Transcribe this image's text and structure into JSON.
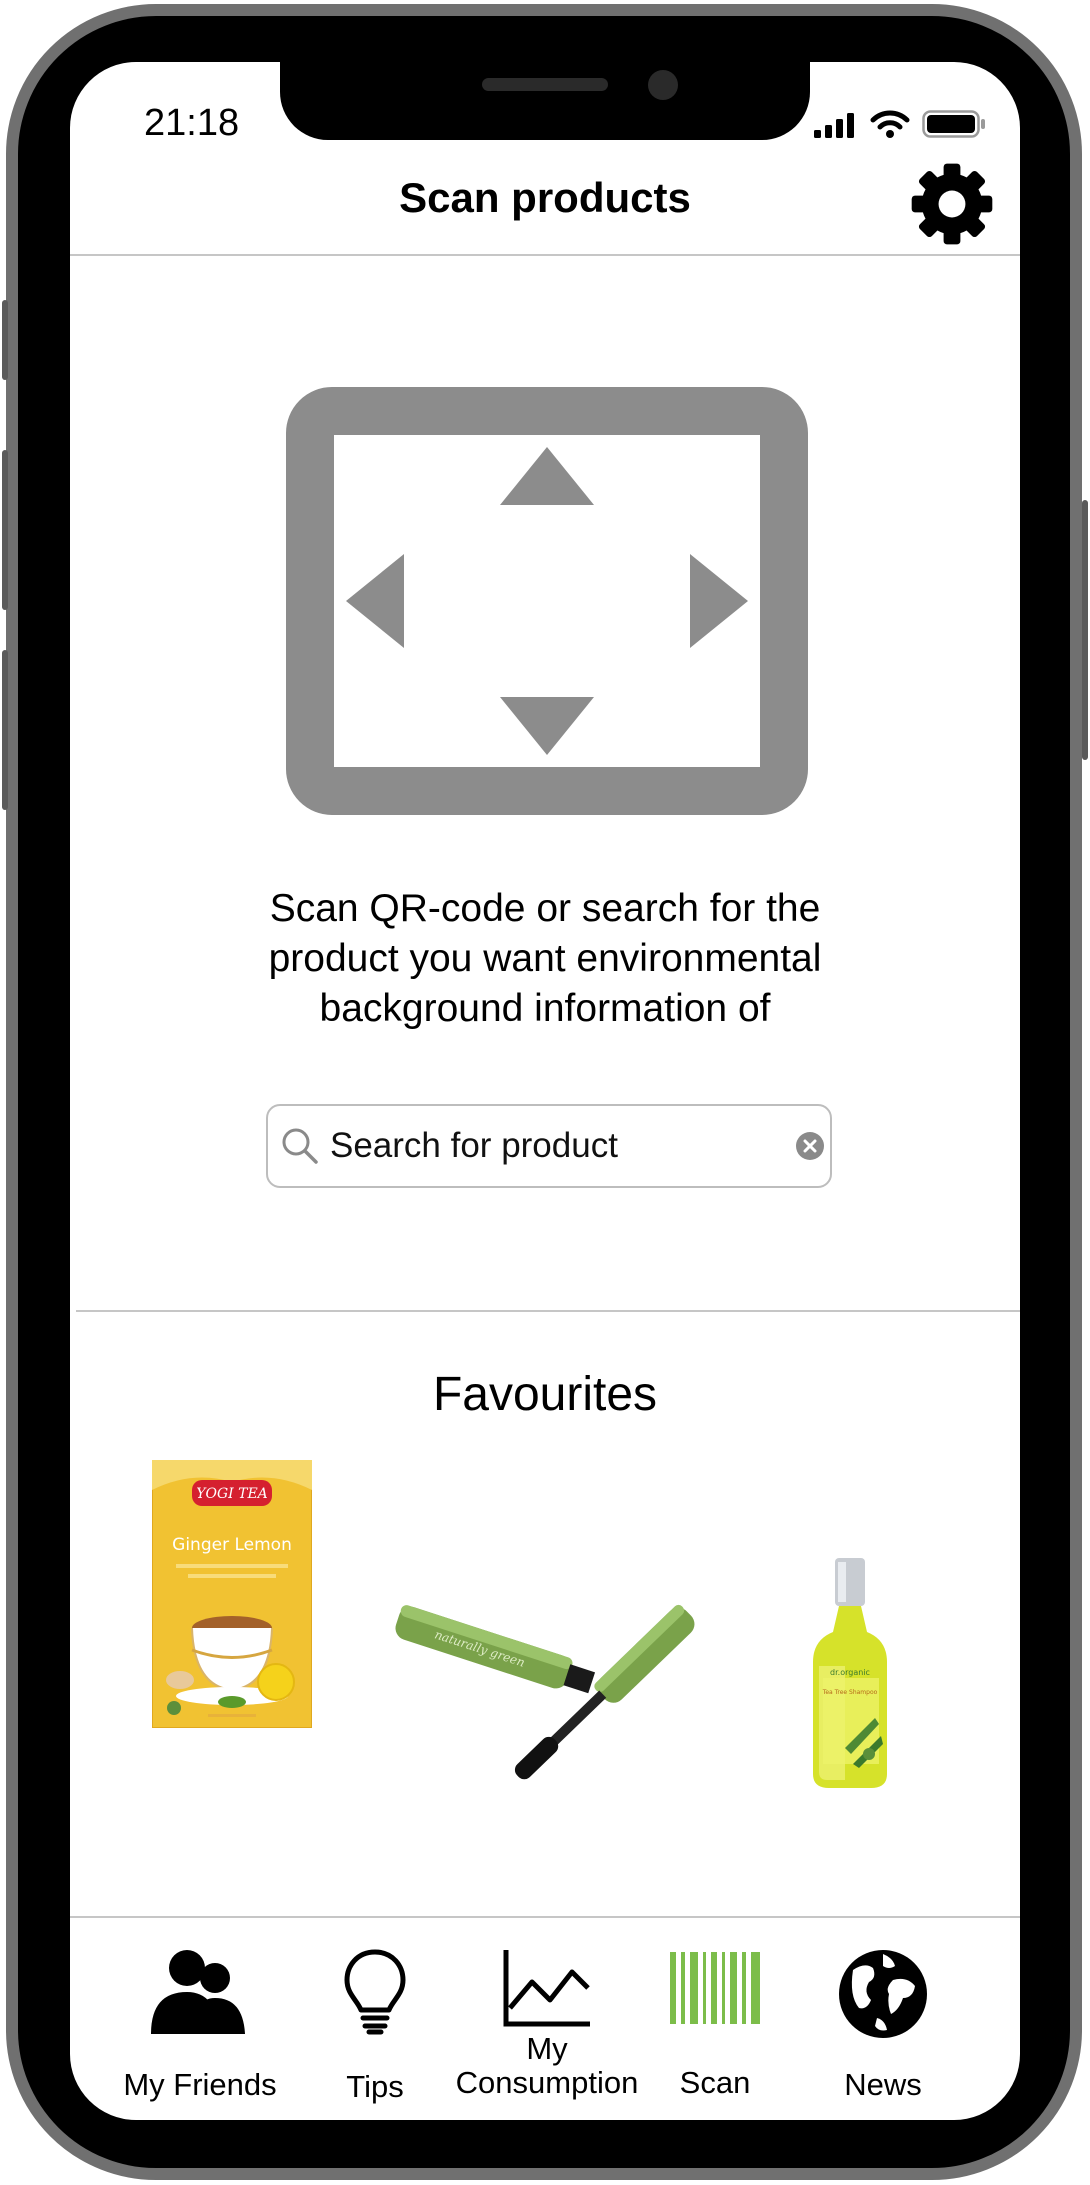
{
  "status_bar": {
    "time": "21:18",
    "icons": [
      "signal-icon",
      "wifi-icon",
      "battery-icon"
    ]
  },
  "header": {
    "title": "Scan products",
    "settings_icon": "gear-icon"
  },
  "scanner": {
    "icon": "scan-frame-icon",
    "instructions": "Scan QR-code or search for the product you want environmental background information of"
  },
  "search": {
    "placeholder": "Search for product",
    "value": ""
  },
  "favourites": {
    "title": "Favourites",
    "items": [
      {
        "name": "Yogi Tea Ginger Lemon",
        "brand": "YOGI TEA",
        "product_text": "Ginger Lemon"
      },
      {
        "name": "Mascara",
        "brand": "naturally green"
      },
      {
        "name": "Tea Tree Shampoo",
        "brand": "dr.organic",
        "product_text": "Tea Tree Shampoo"
      }
    ]
  },
  "tabbar": {
    "tabs": [
      {
        "label": "My Friends",
        "icon": "people-icon"
      },
      {
        "label": "Tips",
        "icon": "lightbulb-icon"
      },
      {
        "label": "My Consumption",
        "label_line1": "My",
        "label_line2": "Consumption",
        "icon": "line-chart-icon"
      },
      {
        "label": "Scan",
        "icon": "barcode-icon",
        "active": true
      },
      {
        "label": "News",
        "icon": "globe-icon"
      }
    ]
  },
  "colors": {
    "frame": "#707070",
    "scan_icon": "#8c8c8c",
    "active_tab": "#7cbd4a",
    "divider": "#c6c6c6"
  }
}
